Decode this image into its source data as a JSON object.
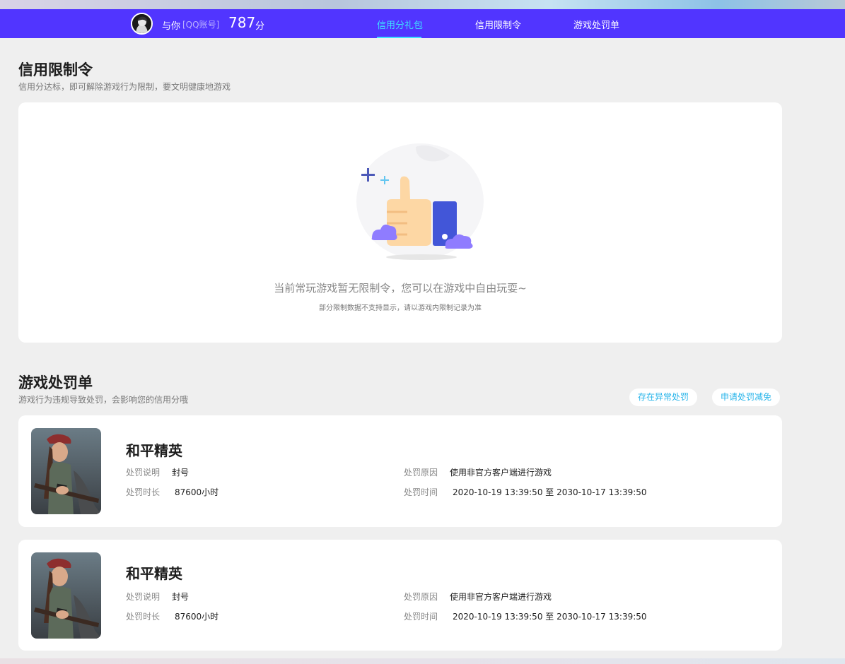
{
  "header": {
    "user_name": "与你",
    "user_tag": "[QQ账号]",
    "score": "787",
    "score_unit": "分",
    "tabs": [
      {
        "label": "信用分礼包",
        "active": true
      },
      {
        "label": "信用限制令",
        "active": false
      },
      {
        "label": "游戏处罚单",
        "active": false
      }
    ],
    "active_color": "#3ee0ff",
    "bar_color": "#5135ff"
  },
  "restriction": {
    "title": "信用限制令",
    "subtitle": "信用分达标，即可解除游戏行为限制，要文明健康地游戏",
    "empty_message": "当前常玩游戏暂无限制令，您可以在游戏中自由玩耍~",
    "empty_note": "部分限制数据不支持显示，请以游戏内限制记录为准"
  },
  "penalty": {
    "title": "游戏处罚单",
    "subtitle": "游戏行为违规导致处罚，会影响您的信用分哦",
    "buttons": {
      "abnormal": "存在异常处罚",
      "appeal": "申请处罚减免"
    },
    "labels": {
      "description": "处罚说明",
      "duration": "处罚时长",
      "reason": "处罚原因",
      "time": "处罚时间"
    },
    "records": [
      {
        "game": "和平精英",
        "description": "封号",
        "duration": "87600小时",
        "reason": "使用非官方客户端进行游戏",
        "time": "2020-10-19 13:39:50 至 2030-10-17 13:39:50"
      },
      {
        "game": "和平精英",
        "description": "封号",
        "duration": "87600小时",
        "reason": "使用非官方客户端进行游戏",
        "time": "2020-10-19 13:39:50 至 2030-10-17 13:39:50"
      }
    ]
  }
}
